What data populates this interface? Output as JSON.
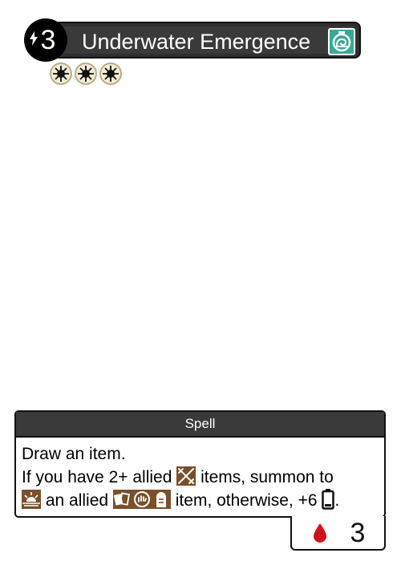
{
  "card": {
    "cost": "3",
    "title": "Underwater Emergence",
    "type_icon": "snail-stopwatch-icon",
    "rarity_count": 3,
    "type_line": "Spell",
    "rules": {
      "line1": "Draw an item.",
      "line2_a": "If you have 2+ allied",
      "line2_b": "items, summon to",
      "line3_a": "an allied",
      "line3_b": "item, otherwise, +6",
      "line3_c": "."
    },
    "stat_value": "3",
    "stat_icon": "blood-drop-icon"
  },
  "colors": {
    "title_bar": "#3a3a3a",
    "type_icon_bg": "#3aa89a",
    "keyword_icon_bg": "#7a4f2a",
    "blood": "#d0121b"
  }
}
